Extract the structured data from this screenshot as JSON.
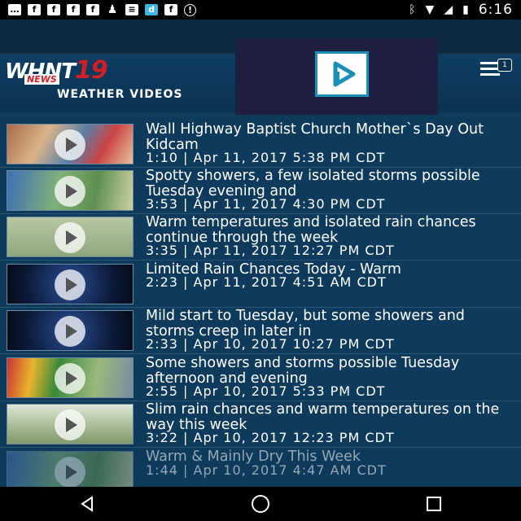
{
  "status_bar": {
    "time": "6:16",
    "left_icons": [
      "notification-icon",
      "facebook-icon",
      "facebook-icon",
      "facebook-icon",
      "facebook-icon",
      "chess-pawn-icon",
      "message-icon",
      "d-app-icon",
      "facebook-icon",
      "info-circle-icon"
    ],
    "right_icons": [
      "bluetooth-icon",
      "wifi-icon",
      "signal-icon",
      "battery-icon"
    ]
  },
  "header": {
    "logo_text": "WHNT",
    "logo_number": "19",
    "logo_sub": "NEWS",
    "section_title": "WEATHER VIDEOS",
    "menu_badge": "1"
  },
  "videos": [
    {
      "title": "Wall Highway Baptist Church Mother`s Day Out Kidcam",
      "meta": "1:10 | Apr 11, 2017 5:38 PM CDT",
      "thumb": "crowd"
    },
    {
      "title": "Spotty showers, a few isolated storms possible Tuesday evening and",
      "meta": "3:53 | Apr 11, 2017 4:30 PM CDT",
      "thumb": "map"
    },
    {
      "title": "Warm temperatures and isolated rain chances continue through the week",
      "meta": "3:35 | Apr 11, 2017 12:27 PM CDT",
      "thumb": "grid"
    },
    {
      "title": "Limited Rain Chances Today - Warm",
      "meta": "2:23 | Apr 11, 2017 4:51 AM CDT",
      "thumb": "dark"
    },
    {
      "title": "Mild start to Tuesday, but some showers and storms creep in later in",
      "meta": "2:33 | Apr 10, 2017 10:27 PM CDT",
      "thumb": "dark"
    },
    {
      "title": "Some showers and storms possible Tuesday afternoon and evening",
      "meta": "2:55 | Apr 10, 2017 5:33 PM CDT",
      "thumb": "radar"
    },
    {
      "title": "Slim rain chances and warm temperatures on the way this week",
      "meta": "3:22 | Apr 10, 2017 12:23 PM CDT",
      "thumb": "sky"
    },
    {
      "title": "Warm & Mainly Dry This Week",
      "meta": "1:44 | Apr 10, 2017 4:47 AM CDT",
      "thumb": "map"
    }
  ],
  "colors": {
    "background": "#0e3a5c",
    "logo_red": "#d21f26",
    "overlay_bg": "#1f2040",
    "overlay_accent": "#1a8fb8"
  }
}
